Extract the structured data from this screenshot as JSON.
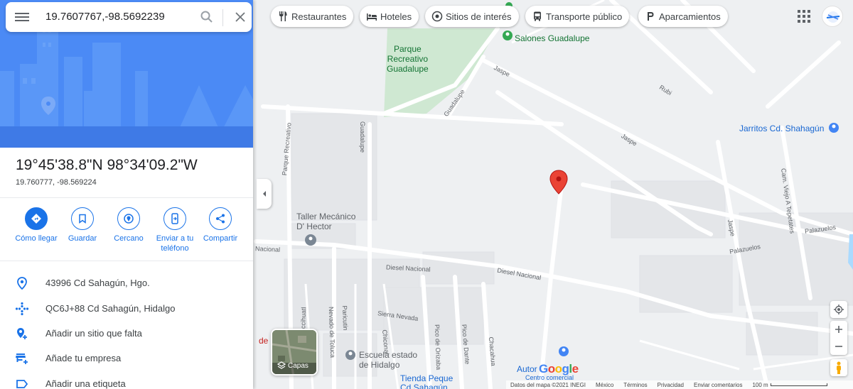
{
  "search": {
    "query": "19.7607767,-98.5692239"
  },
  "place": {
    "title": "19°45'38.8\"N 98°34'09.2\"W",
    "decimal": "19.760777, -98.569224"
  },
  "actions": [
    {
      "label": "Cómo llegar",
      "icon": "directions-icon"
    },
    {
      "label": "Guardar",
      "icon": "bookmark-icon"
    },
    {
      "label": "Cercano",
      "icon": "nearby-icon"
    },
    {
      "label": "Enviar a tu teléfono",
      "icon": "send-to-phone-icon"
    },
    {
      "label": "Compartir",
      "icon": "share-icon"
    }
  ],
  "info": [
    {
      "text": "43996 Cd Sahagún, Hgo.",
      "icon": "location-pin-icon"
    },
    {
      "text": "QC6J+88 Cd Sahagún, Hidalgo",
      "icon": "plus-code-icon"
    },
    {
      "text": "Añadir un sitio que falta",
      "icon": "add-place-icon"
    },
    {
      "text": "Añade tu empresa",
      "icon": "add-business-icon"
    },
    {
      "text": "Añadir una etiqueta",
      "icon": "label-icon"
    }
  ],
  "chips": [
    {
      "label": "Restaurantes",
      "icon": "restaurant-icon"
    },
    {
      "label": "Hoteles",
      "icon": "hotel-icon"
    },
    {
      "label": "Sitios de interés",
      "icon": "camera-icon"
    },
    {
      "label": "Transporte público",
      "icon": "transit-icon"
    },
    {
      "label": "Aparcamientos",
      "icon": "parking-icon"
    }
  ],
  "map": {
    "park_label": "Parque\nRecreativo\nGuadalupe",
    "pois": {
      "salones": "Salones Guadalupe",
      "jarritos": "Jarritos Cd. Shahagún",
      "taller": "Taller Mecánico\nD' Hector",
      "escuela": "Escuela estado\nde Hidalgo",
      "tienda": "Tienda Peque\nCd Sahagún",
      "autor": "Autor",
      "centro": "Centro comercial",
      "de": "de"
    },
    "streets": {
      "jaspe1": "Jaspe",
      "jaspe2": "Jaspe",
      "jaspe3": "Jaspe",
      "rubi": "Rubi",
      "guadalupe_diag": "Guadalupe",
      "guadalupe_vert": "Guadalupe",
      "parque_recreativo": "Parque Recreativo",
      "diesel1": "Diesel Nacional",
      "diesel2": "Diesel Nacional",
      "nacional": "Nacional",
      "palazuelos1": "Palazuelos",
      "palazuelos2": "Palazuelos",
      "camino": "Cam. Viejo A Tepetates",
      "izta": "Iztaccihuatl",
      "nevado": "Nevado de Toluca",
      "paricutin": "Paricutin",
      "sierra": "Sierra Nevada",
      "chiconal": "Chiconal",
      "orizaba": "Pico de Orizaba",
      "dante": "Pico de Dante",
      "chacahua": "Chacahua"
    },
    "layers_label": "Capas",
    "colors": {
      "water": "#aadaff",
      "park": "#c8e6c9",
      "pin": "#ea4335",
      "accent": "#1a73e8"
    }
  },
  "footer": {
    "data": "Datos del mapa ©2021 INEGI",
    "country": "México",
    "terms": "Términos",
    "privacy": "Privacidad",
    "feedback": "Enviar comentarios",
    "scale": "100 m"
  },
  "google_logo": "Google"
}
